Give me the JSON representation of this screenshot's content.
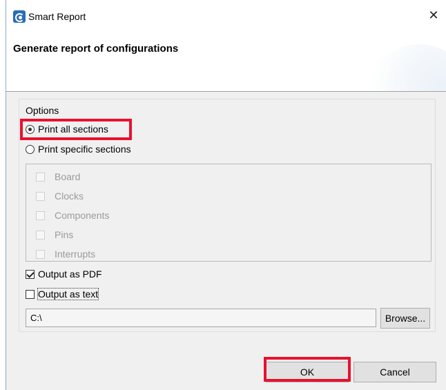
{
  "window": {
    "title": "Smart Report",
    "close_glyph": "✕",
    "icon": "smart-report-app-icon"
  },
  "banner": {
    "heading": "Generate report of configurations"
  },
  "options": {
    "legend": "Options",
    "print_all": {
      "label": "Print all sections",
      "checked": true
    },
    "print_specific": {
      "label": "Print specific sections",
      "checked": false
    },
    "sections": [
      {
        "label": "Board",
        "checked": false,
        "enabled": false
      },
      {
        "label": "Clocks",
        "checked": false,
        "enabled": false
      },
      {
        "label": "Components",
        "checked": false,
        "enabled": false
      },
      {
        "label": "Pins",
        "checked": false,
        "enabled": false
      },
      {
        "label": "Interrupts",
        "checked": false,
        "enabled": false
      }
    ],
    "output_pdf": {
      "label": "Output as PDF",
      "checked": true
    },
    "output_text": {
      "label": "Output as text",
      "checked": false
    },
    "output_path": {
      "value": "C:\\"
    },
    "browse_label": "Browse..."
  },
  "footer": {
    "ok_label": "OK",
    "cancel_label": "Cancel"
  },
  "colors": {
    "highlight": "#e8112d",
    "dialog_bg": "#f0f0f0",
    "disabled_text": "#9a9a9a"
  }
}
